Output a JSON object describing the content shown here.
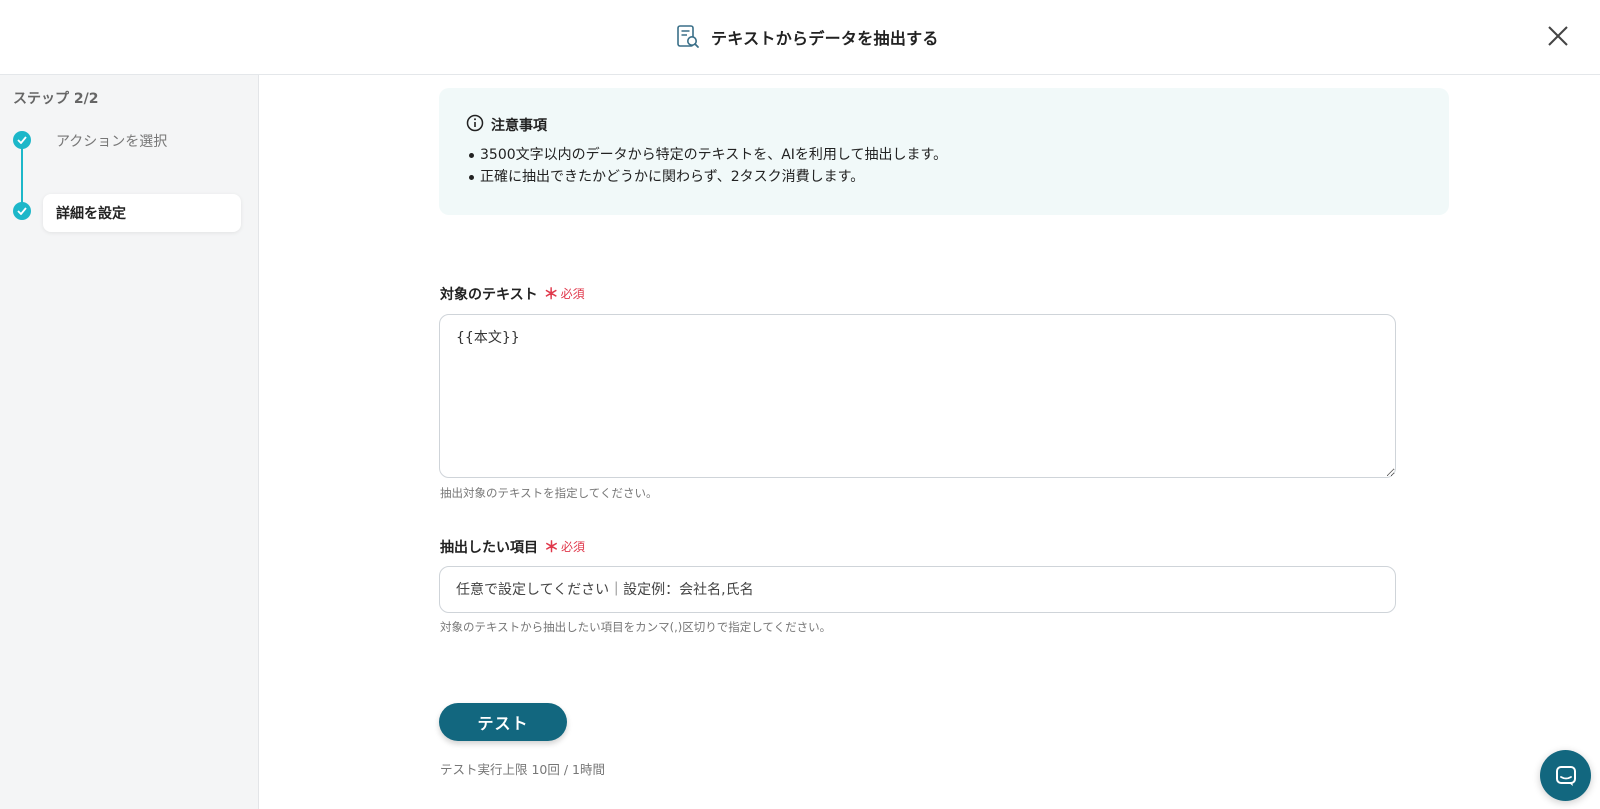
{
  "header": {
    "title": "テキストからデータを抽出する",
    "icon": "document-search-icon",
    "close_icon": "close-icon"
  },
  "sidebar": {
    "step_label": "ステップ 2/2",
    "steps": [
      {
        "label": "アクションを選択",
        "state": "completed"
      },
      {
        "label": "詳細を設定",
        "state": "completed-active"
      }
    ],
    "accent_color": "#1cb7c9"
  },
  "notice": {
    "title": "注意事項",
    "items": [
      "3500文字以内のデータから特定のテキストを、AIを利用して抽出します。",
      "正確に抽出できたかどうかに関わらず、2タスク消費します。"
    ],
    "background": "#f1f9f9"
  },
  "fields": {
    "target_text": {
      "label": "対象のテキスト",
      "required_mark": "＊",
      "required_text": "必須",
      "value": "{{本文}}",
      "hint": "抽出対象のテキストを指定してください。"
    },
    "extract_items": {
      "label": "抽出したい項目",
      "required_mark": "＊",
      "required_text": "必須",
      "placeholder": "任意で設定してください｜設定例：会社名,氏名",
      "value": "",
      "hint": "対象のテキストから抽出したい項目をカンマ(,)区切りで指定してください。"
    }
  },
  "actions": {
    "test_button": "テスト",
    "test_limit": "テスト実行上限 10回 / 1時間",
    "primary_color": "#12677f"
  },
  "chat_launcher": {
    "icon": "chat-icon"
  }
}
